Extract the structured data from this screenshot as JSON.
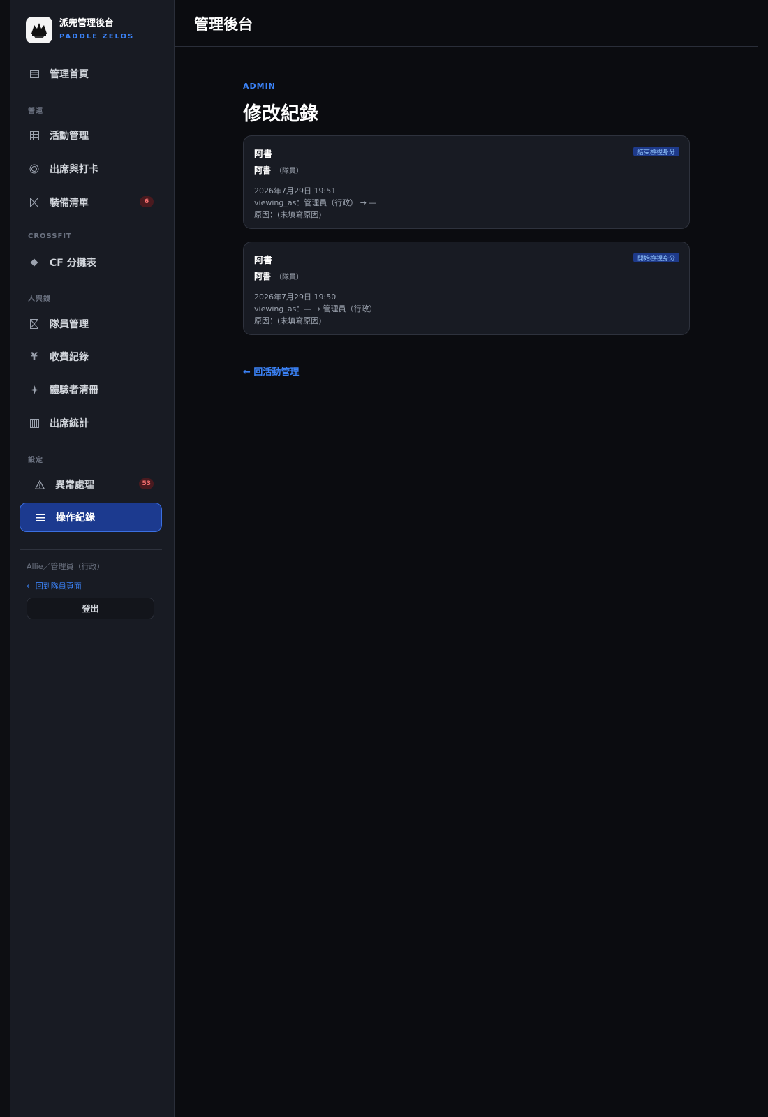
{
  "brand": {
    "title": "派兜管理後台",
    "subtitle": "PADDLE ZELOS"
  },
  "sidebar": {
    "home": {
      "icon": "list-icon",
      "label": "管理首頁"
    },
    "sections": {
      "operations": "營運",
      "crossfit": "CROSSFIT",
      "people_money": "人與錢",
      "settings": "設定"
    },
    "items": [
      {
        "icon": "grid-icon",
        "label": "活動管理"
      },
      {
        "icon": "target-icon",
        "label": "出席與打卡"
      },
      {
        "icon": "box-icon",
        "label": "裝備清單",
        "badge": "6"
      },
      {
        "icon": "diamond-icon",
        "label": "CF 分攤表"
      },
      {
        "icon": "box-icon",
        "label": "隊員管理"
      },
      {
        "icon": "yen-icon",
        "label": "收費紀錄"
      },
      {
        "icon": "sparkle-icon",
        "label": "體驗者清冊"
      },
      {
        "icon": "bars-icon",
        "label": "出席統計"
      },
      {
        "icon": "warning-icon",
        "label": "異常處理",
        "badge": "53"
      },
      {
        "icon": "menu-icon",
        "label": "操作紀錄",
        "active": true
      }
    ],
    "user": "Allie／管理員（行政）",
    "back_to_member": "← 回到隊員頁面",
    "logout": "登出"
  },
  "topbar": {
    "title": "管理後台"
  },
  "main": {
    "eyebrow": "ADMIN",
    "title": "修改紀錄",
    "records": [
      {
        "name": "阿書",
        "tag": "結束檢視身分",
        "actor": "阿書",
        "actor_role": "（隊員）",
        "time": "2026年7月29日 19:51",
        "change": "viewing_as：管理員（行政） → —",
        "reason": "原因：(未填寫原因)"
      },
      {
        "name": "阿書",
        "tag": "開始檢視身分",
        "actor": "阿書",
        "actor_role": "（隊員）",
        "time": "2026年7月29日 19:50",
        "change": "viewing_as：— → 管理員（行政）",
        "reason": "原因：(未填寫原因)"
      }
    ],
    "back_link": "← 回活動管理"
  }
}
